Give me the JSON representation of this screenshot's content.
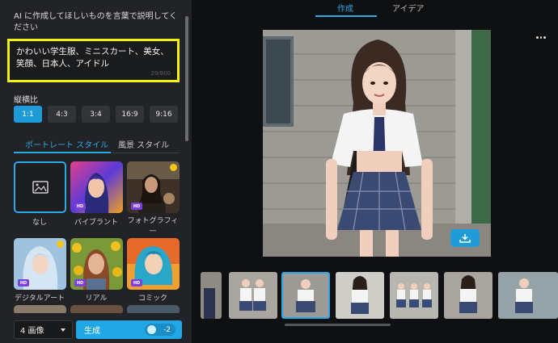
{
  "prompt": {
    "label": "AI に作成してほしいものを言葉で説明してください",
    "text": "かわいい学生服、ミニスカート、美女、笑顔、日本人、アイドル",
    "count": "29/800"
  },
  "aspect": {
    "label": "縦横比",
    "options": [
      "1:1",
      "4:3",
      "3:4",
      "16:9",
      "9:16"
    ],
    "selected": "1:1"
  },
  "style_tabs": {
    "portrait": "ポートレート スタイル",
    "landscape": "風景 スタイル"
  },
  "styles": [
    {
      "label": "なし"
    },
    {
      "label": "バイブラント",
      "badge": "HD"
    },
    {
      "label": "フォトグラフィ—",
      "badge": "HD"
    },
    {
      "label": "デジタルアート",
      "badge": "HD"
    },
    {
      "label": "リアル",
      "badge": "HD"
    },
    {
      "label": "コミック",
      "badge": "HD"
    }
  ],
  "bottom": {
    "count_select": "4 画像",
    "generate": "生成",
    "cost": "-2"
  },
  "main_tabs": {
    "create": "作成",
    "idea": "アイデア"
  },
  "colors": {
    "accent": "#22a7e6",
    "highlight_box": "#f2f20a",
    "hd_badge": "#7b3fe0"
  }
}
